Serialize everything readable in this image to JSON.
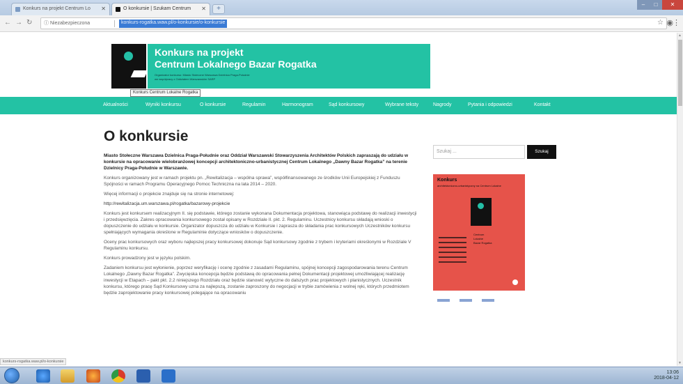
{
  "browser": {
    "tabs": [
      {
        "label": "Konkurs na projekt Centrum Lo"
      },
      {
        "label": "O konkursie | Szukam Centrum"
      }
    ],
    "address": {
      "info": "Niezabezpieczona",
      "url": "konkurs-rogatka.waw.pl/o-konkursie/o-konkursie"
    }
  },
  "site": {
    "banner_line1": "Konkurs na projekt",
    "banner_line2": "Centrum Lokalnego Bazar Rogatka",
    "banner_sub1": "Organizator konkursu: Miasto Stołeczne Warszawa Dzielnica Praga-Południe",
    "banner_sub2": "we współpracy z Oddziałem Warszawskim SARP",
    "logo_tooltip": "Konkurs Centrum Lokalne Rogatka"
  },
  "nav": [
    {
      "label": "Aktualności"
    },
    {
      "label": "Wyniki konkursu"
    },
    {
      "label": "O konkursie"
    },
    {
      "label": "Regulamin"
    },
    {
      "label": "Harmonogram"
    },
    {
      "label": "Sąd konkursowy"
    },
    {
      "label": "Wybrane teksty"
    },
    {
      "label": "Nagrody"
    },
    {
      "label": "Pytania i odpowiedzi"
    },
    {
      "label": "Kontakt"
    }
  ],
  "main": {
    "title": "O konkursie",
    "paragraphs": [
      {
        "text": "Miasto Stołeczne Warszawa Dzielnica Praga-Południe oraz Oddział Warszawski Stowarzyszenia Architektów Polskich zapraszają do udziału w konkursie na opracowanie wielobranżowej koncepcji architektoniczno-urbanistycznej Centrum Lokalnego „Dawny Bazar Rogatka” na terenie Dzielnicy Praga-Południe w Warszawie.",
        "style": "bold"
      },
      {
        "text": "Konkurs organizowany jest w ramach projektu pn. „Rewitalizacja – wspólna sprawa”, współfinansowanego ze środków Unii Europejskiej z Funduszu Spójności w ramach Programu Operacyjnego Pomoc Techniczna na lata 2014 – 2020.",
        "style": "normal"
      },
      {
        "text": "Więcej informacji o projekcie znajduje się na stronie internetowej:",
        "style": "normal"
      },
      {
        "text": "http://rewitalizacja.um.warszawa.pl/rogatka/bazarowy-projekcie",
        "style": "link"
      },
      {
        "text": "Konkurs jest konkursem realizacyjnym II. się podstawie, którego zostanie wykonana Dokumentacja projektowa, stanowiąca podstawę do realizacji inwestycji i przedsięwzięcia. Zakres opracowania konkursowego został opisany w Rozdziale II. pkt. 2. Regulaminu. Uczestnicy konkursu składają wnioski o dopuszczenie do udziału w konkursie. Organizator dopuszcza do udziału w Konkursie i zaprasza do składania prac konkursowych Uczestników konkursu spełniających wymagania określone w Regulaminie dotyczące wniosków o dopuszczenie.",
        "style": "normal"
      },
      {
        "text": "Oceny prac konkursowych oraz wyboru najlepszej pracy konkursowej dokonuje Sąd konkursowy zgodnie z trybem i kryteriami określonymi w Rozdziale V Regulaminu konkursu.",
        "style": "normal"
      },
      {
        "text": "Konkurs prowadzony jest w języku polskim.",
        "style": "normal"
      },
      {
        "text": "Zadaniem konkursu jest wyłonienie, poprzez weryfikację i ocenę zgodnie z zasadami Regulaminu, spójnej koncepcji zagospodarowania terenu Centrum Lokalnego „Dawny Bazar Rogatka”. Zwycięska koncepcja będzie podstawą do opracowania pełnej Dokumentacji projektowej umożliwiającej realizację inwestycji w Etapach – pakt pkt. 2.2 niniejszego Rozdziału oraz będzie stanowić wytyczne do dalszych prac projektowych i planistycznych. Uczestnik konkursu, którego pracę Sąd Konkursowy uzna za najlepszą, zostanie zaproszony do negocjacji w trybie zamówienia z wolnej ręki, których przedmiotem będzie zaprojektowanie pracy konkursowej polegające na opracowaniu",
        "style": "normal"
      }
    ]
  },
  "sidebar": {
    "search_placeholder": "Szukaj ...",
    "search_button": "Szukaj",
    "poster_title": "Konkurs",
    "poster_sub": "architektoniczno-urbanistyczny na Centrum Lokalne",
    "poster_text_line1": "Centrum",
    "poster_text_line2": "Lokalne",
    "poster_text_line3": "Bazar Rogatka"
  },
  "status_bar": "konkurs-rogatka.waw.pl/o-konkursie",
  "taskbar": {
    "clock_time": "13:06",
    "clock_date": "2018-04-12"
  },
  "colors": {
    "accent": "#23c2a4",
    "poster": "#e6534a",
    "dark": "#111111"
  }
}
